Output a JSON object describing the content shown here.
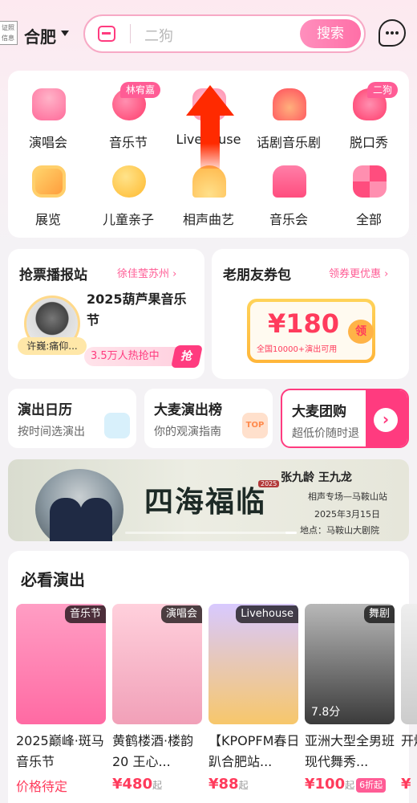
{
  "header": {
    "cert_badge_line1": "证照",
    "cert_badge_line2": "信息",
    "city": "合肥",
    "search_placeholder": "二狗",
    "search_button": "搜索"
  },
  "categories": [
    {
      "label": "演唱会",
      "icon": "microphone-icon",
      "badge": ""
    },
    {
      "label": "音乐节",
      "icon": "music-note-icon",
      "badge": "林宥嘉"
    },
    {
      "label": "Livehouse",
      "icon": "guitar-icon",
      "badge": ""
    },
    {
      "label": "话剧音乐剧",
      "icon": "theater-icon",
      "badge": ""
    },
    {
      "label": "脱口秀",
      "icon": "lips-icon",
      "badge": "二狗"
    },
    {
      "label": "展览",
      "icon": "picture-frame-icon",
      "badge": ""
    },
    {
      "label": "儿童亲子",
      "icon": "duck-icon",
      "badge": ""
    },
    {
      "label": "相声曲艺",
      "icon": "fan-icon",
      "badge": ""
    },
    {
      "label": "音乐会",
      "icon": "piano-icon",
      "badge": ""
    },
    {
      "label": "全部",
      "icon": "grid-icon",
      "badge": ""
    }
  ],
  "promo_left": {
    "title": "抢票播报站",
    "subtitle": "徐佳莹苏州",
    "subtitle_arrow": "›",
    "artist_tag": "许巍:痛仰...",
    "event": "2025葫芦果音乐节",
    "hot": "3.5万人热抢中",
    "flash": "抢"
  },
  "promo_right": {
    "title": "老朋友券包",
    "subtitle": "领券更优惠",
    "subtitle_arrow": "›",
    "coupon_amount": "¥180",
    "coupon_desc": "全国10000+演出可用",
    "coupon_button": "领"
  },
  "mini_cards": [
    {
      "title": "演出日历",
      "subtitle": "按时间选演出",
      "icon": "calendar-icon"
    },
    {
      "title": "大麦演出榜",
      "subtitle": "你的观演指南",
      "icon": "top-badge-icon",
      "icon_text": "TOP"
    },
    {
      "title": "大麦团购",
      "subtitle": "超低价随时退",
      "icon": "arrow-right-icon"
    }
  ],
  "banner": {
    "title": "四海福临",
    "year": "2025",
    "names": "张九龄 王九龙",
    "venue": "相声专场—马鞍山站",
    "date": "2025年3月15日",
    "place": "地点：马鞍山大剧院"
  },
  "must_see": {
    "title": "必看演出",
    "shows": [
      {
        "name": "2025巅峰·斑马音乐节",
        "tag": "音乐节",
        "price_text": "价格待定",
        "price": "",
        "unit": "",
        "discount": "",
        "score": "",
        "poster_colors": [
          "#ff9ec4",
          "#ff6aa3"
        ]
      },
      {
        "name": "黄鹤楼酒·楼韵20 王心...",
        "tag": "演唱会",
        "price_text": "",
        "price": "¥480",
        "unit": "起",
        "discount": "",
        "score": "",
        "poster_colors": [
          "#ffd0dc",
          "#f1a0b8"
        ]
      },
      {
        "name": "【KPOPFM春日趴合肥站...",
        "tag": "Livehouse",
        "price_text": "",
        "price": "¥88",
        "unit": "起",
        "discount": "",
        "score": "",
        "poster_colors": [
          "#d8c9ff",
          "#f7c76b"
        ]
      },
      {
        "name": "亚洲大型全男班现代舞秀...",
        "tag": "舞剧",
        "price_text": "",
        "price": "¥100",
        "unit": "起",
        "discount": "6折起",
        "score": "7.8分",
        "poster_colors": [
          "#b8b8b8",
          "#3b3b3b"
        ]
      },
      {
        "name": "开爆",
        "tag": "",
        "price_text": "",
        "price": "¥",
        "unit": "",
        "discount": "",
        "score": "",
        "poster_colors": [
          "#eee",
          "#ccc"
        ]
      }
    ]
  },
  "colors": {
    "accent": "#ff3b7f",
    "price": "#ff3b5c",
    "page_bg": "#f4f2f5"
  }
}
